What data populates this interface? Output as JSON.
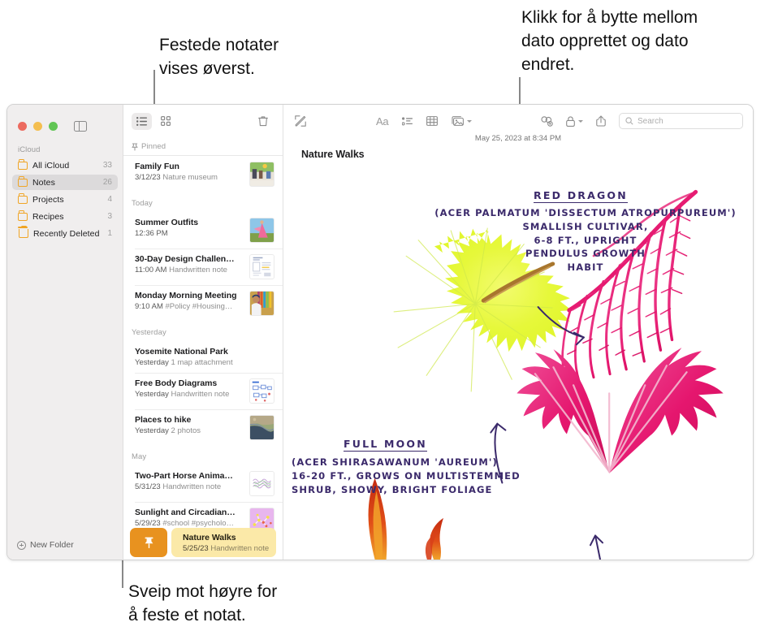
{
  "annotations": {
    "pinned_note": "Festede notater\nvises øverst.",
    "date_toggle": "Klikk for å bytte mellom\ndato opprettet og dato\nendret.",
    "swipe_to_pin": "Sveip mot høyre for\nå feste et notat."
  },
  "window": {
    "traffic_lights": {
      "close": "close",
      "minimize": "minimize",
      "zoom": "zoom"
    },
    "sidebar_toggle_label": "sidebar-toggle"
  },
  "sidebar": {
    "section_label": "iCloud",
    "items": [
      {
        "label": "All iCloud",
        "count": "33",
        "icon": "folder-icon",
        "selected": false
      },
      {
        "label": "Notes",
        "count": "26",
        "icon": "folder-icon",
        "selected": true
      },
      {
        "label": "Projects",
        "count": "4",
        "icon": "folder-icon",
        "selected": false
      },
      {
        "label": "Recipes",
        "count": "3",
        "icon": "folder-icon",
        "selected": false
      },
      {
        "label": "Recently Deleted",
        "count": "1",
        "icon": "trash-icon",
        "selected": false
      }
    ],
    "new_folder_label": "New Folder"
  },
  "notes_list": {
    "toolbar": {
      "list_view": "list-view-icon",
      "gallery_view": "gallery-view-icon",
      "delete": "trash-icon"
    },
    "groups": [
      {
        "label": "Pinned",
        "pinned": true,
        "notes": [
          {
            "title": "Family Fun",
            "date": "3/12/23",
            "meta": "Nature museum",
            "thumb": "photo-museum"
          }
        ]
      },
      {
        "label": "Today",
        "pinned": false,
        "notes": [
          {
            "title": "Summer Outfits",
            "date": "12:36 PM",
            "meta": "",
            "thumb": "photo-dress"
          },
          {
            "title": "30-Day Design Challen…",
            "date": "11:00 AM",
            "meta": "Handwritten note",
            "thumb": "doc-sketch"
          },
          {
            "title": "Monday Morning Meeting",
            "date": "9:10 AM",
            "meta": "#Policy #Housing…",
            "thumb": "photo-person"
          }
        ]
      },
      {
        "label": "Yesterday",
        "pinned": false,
        "notes": [
          {
            "title": "Yosemite National Park",
            "date": "Yesterday",
            "meta": "1 map attachment",
            "thumb": ""
          },
          {
            "title": "Free Body Diagrams",
            "date": "Yesterday",
            "meta": "Handwritten note",
            "thumb": "doc-diagram"
          },
          {
            "title": "Places to hike",
            "date": "Yesterday",
            "meta": "2 photos",
            "thumb": "photo-map"
          }
        ]
      },
      {
        "label": "May",
        "pinned": false,
        "notes": [
          {
            "title": "Two-Part Horse Anima…",
            "date": "5/31/23",
            "meta": "Handwritten note",
            "thumb": "doc-scribble"
          },
          {
            "title": "Sunlight and Circadian…",
            "date": "5/29/23",
            "meta": "#school #psycholo…",
            "thumb": "photo-violet"
          }
        ]
      }
    ],
    "swipe_row": {
      "pin_action_icon": "pin-icon",
      "selected_note": {
        "title": "Nature Walks",
        "date": "5/25/23",
        "meta": "Handwritten note"
      }
    }
  },
  "editor": {
    "toolbar": {
      "compose": "compose-icon",
      "format": "Aa",
      "checklist": "checklist-icon",
      "table": "table-icon",
      "media": "media-icon",
      "collaborate": "collaborate-icon",
      "lock": "lock-icon",
      "share": "share-icon",
      "search_placeholder": "Search",
      "search_value": ""
    },
    "date": "May 25, 2023 at 8:34 PM",
    "note_title": "Nature Walks",
    "handwriting": {
      "red_dragon_heading": "RED DRAGON",
      "red_dragon_body": "(ACER PALMATUM 'DISSECTUM ATROPURPUREUM')\nSMALLISH CULTIVAR,\n6-8 FT., UPRIGHT\nPENDULUS GROWTH\nHABIT",
      "full_moon_heading": "FULL MOON",
      "full_moon_body": "(ACER SHIRASAWANUM 'AUREUM')\n16-20 FT., GROWS ON MULTISTEMMED\nSHRUB, SHOWY, BRIGHT FOLIAGE"
    }
  },
  "colors": {
    "accent_orange": "#e8921f",
    "selected_note_bg": "#fbe9a8",
    "folder_icon": "#f0a526",
    "handwriting_ink": "#3b2a6b",
    "leaf_yellow": "#e3f72b",
    "leaf_magenta": "#e8246e",
    "leaf_red": "#d93a1a"
  }
}
